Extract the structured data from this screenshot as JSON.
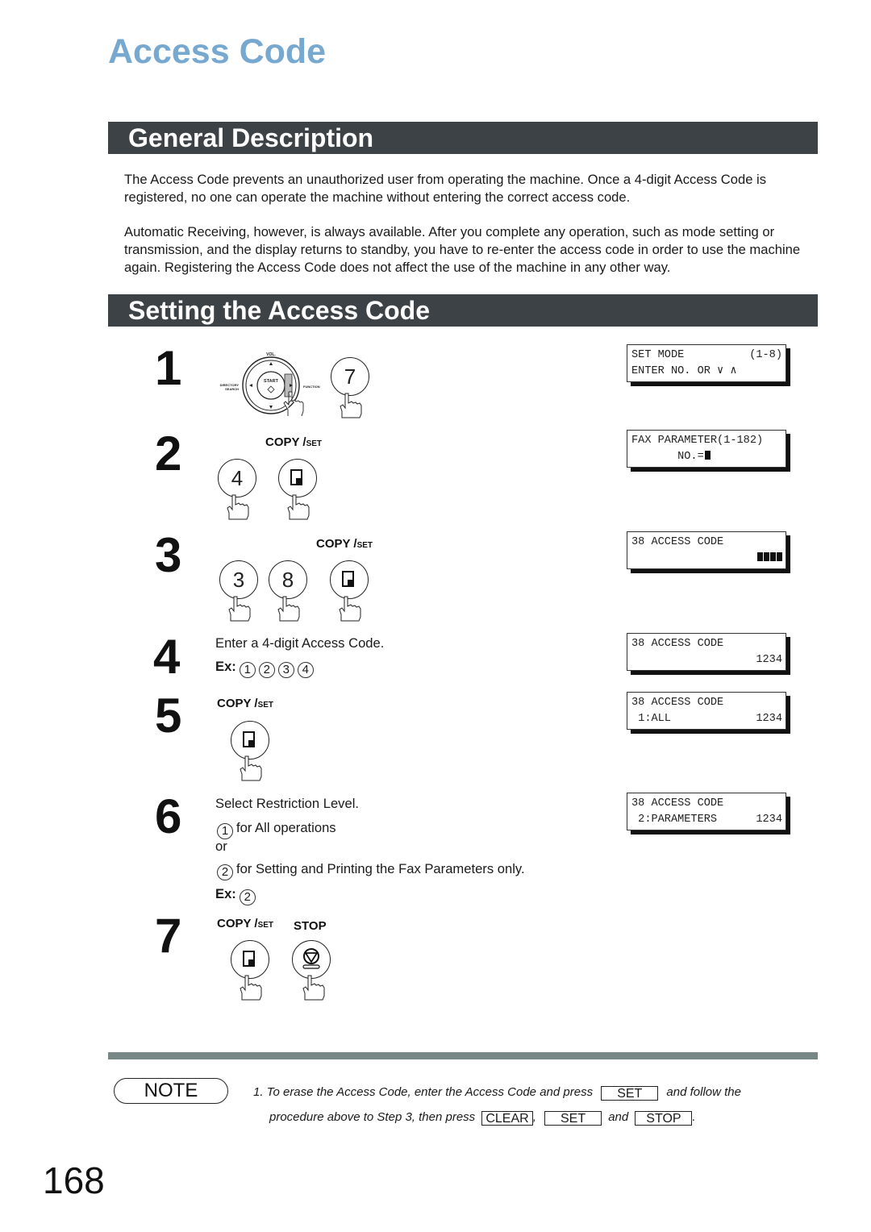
{
  "page": {
    "title": "Access Code",
    "page_number": "168"
  },
  "sections": {
    "general": {
      "heading": "General Description",
      "paragraphs": [
        "The Access Code prevents an unauthorized user from operating the machine.  Once a 4-digit Access Code is registered, no one can operate the machine without entering the correct access code.",
        "Automatic Receiving, however, is always available.  After you complete any operation, such as mode setting or transmission, and the display returns to standby, you have to re-enter the access code in order to use the machine again.  Registering the Access Code does not affect the use of the machine in any other way."
      ]
    },
    "setting": {
      "heading": "Setting the Access Code"
    }
  },
  "labels": {
    "copy": "COPY /",
    "set_small": "SET",
    "stop": "STOP",
    "vol": "↕VOL.",
    "start": "START",
    "directory": "DIRECTORY",
    "search": "SEARCH",
    "function": "FUNCTION",
    "ex": "Ex:"
  },
  "steps": [
    {
      "number": "1",
      "keys": [
        "7"
      ],
      "lcd": [
        [
          "SET MODE",
          "(1-8)"
        ],
        [
          "ENTER NO. OR ∨ ∧",
          ""
        ]
      ]
    },
    {
      "number": "2",
      "keys": [
        "4"
      ],
      "lcd": [
        [
          "FAX PARAMETER(1-182)",
          ""
        ],
        [
          "       NO.=",
          ""
        ]
      ]
    },
    {
      "number": "3",
      "keys": [
        "3",
        "8"
      ],
      "lcd": [
        [
          "38 ACCESS CODE",
          ""
        ],
        [
          "",
          "■■■■"
        ]
      ]
    },
    {
      "number": "4",
      "text": "Enter a 4-digit Access Code.",
      "example_keys": [
        "1",
        "2",
        "3",
        "4"
      ],
      "lcd": [
        [
          "38 ACCESS CODE",
          ""
        ],
        [
          "",
          "1234"
        ]
      ]
    },
    {
      "number": "5",
      "lcd": [
        [
          "38 ACCESS CODE",
          ""
        ],
        [
          " 1:ALL",
          "1234"
        ]
      ]
    },
    {
      "number": "6",
      "text": "Select Restriction Level.",
      "options": [
        {
          "key": "1",
          "text": "for All operations"
        },
        {
          "key": "2",
          "text": "for Setting and Printing the Fax Parameters only."
        }
      ],
      "or_text": "or",
      "example_keys": [
        "2"
      ],
      "lcd": [
        [
          "38 ACCESS CODE",
          ""
        ],
        [
          " 2:PARAMETERS",
          "1234"
        ]
      ]
    },
    {
      "number": "7"
    }
  ],
  "note": {
    "label": "NOTE",
    "line1_pre": "1.  To erase the Access Code, enter the Access Code and press",
    "line1_key": "SET",
    "line1_post": "and follow the",
    "line2_pre": "procedure above to Step 3, then press",
    "line2_key1": "CLEAR",
    "line2_sep": ",",
    "line2_key2": "SET",
    "line2_and": "and",
    "line2_key3": "STOP",
    "line2_end": "."
  },
  "colors": {
    "title": "#77a8d0",
    "section_bar": "#3c4245",
    "footer_bar": "#778785"
  }
}
